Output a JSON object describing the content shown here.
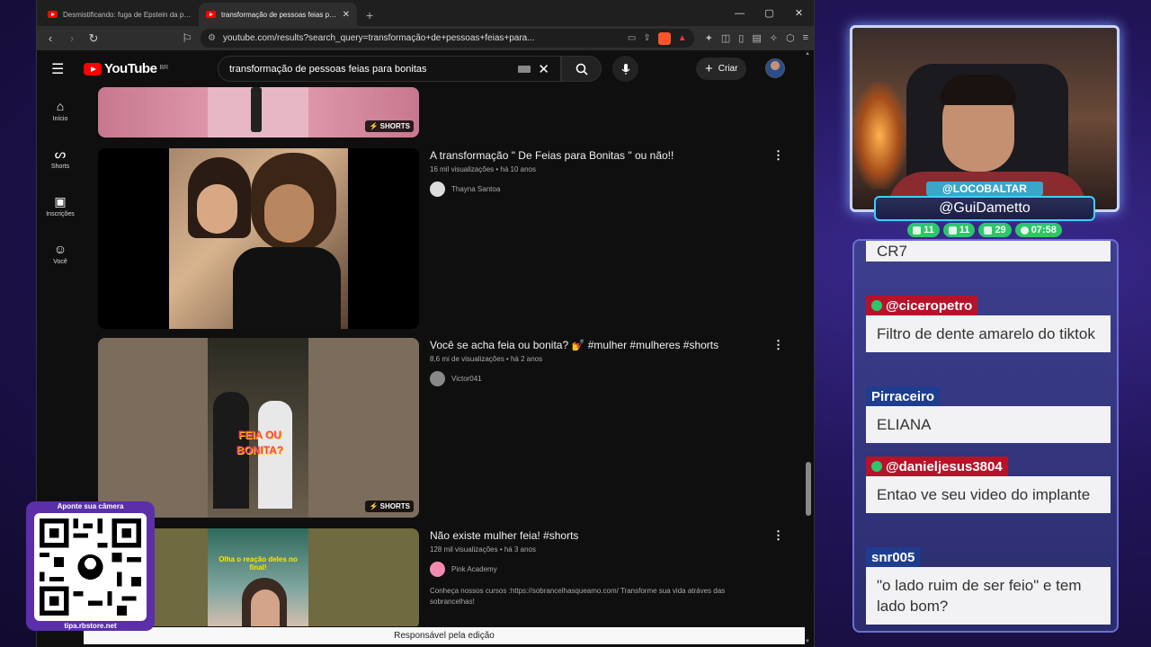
{
  "browser": {
    "tabs": [
      {
        "title": "Desmistificando: fuga de Epstein da prisão e",
        "active": false
      },
      {
        "title": "transformação de pessoas feias para b",
        "active": true
      }
    ],
    "url": "youtube.com/results?search_query=transformação+de+pessoas+feias+para..."
  },
  "youtube": {
    "logo_text": "YouTube",
    "country": "BR",
    "search_query": "transformação de pessoas feias para bonitas",
    "create_label": "Criar",
    "sidebar": [
      {
        "label": "Início",
        "icon": "home-icon",
        "glyph": "⌂"
      },
      {
        "label": "Shorts",
        "icon": "shorts-icon",
        "glyph": "ᔕ"
      },
      {
        "label": "Inscrições",
        "icon": "subscriptions-icon",
        "glyph": "▣"
      },
      {
        "label": "Você",
        "icon": "you-icon",
        "glyph": "☺"
      }
    ],
    "shorts_badge": "SHORTS",
    "videos": [
      {
        "title": "A transformação \" De Feias para Bonitas \" ou não!!",
        "meta": "16 mil visualizações • há 10 anos",
        "channel": "Thayna Santoa"
      },
      {
        "title": "Você se acha feia ou bonita? 💅 #mulher #mulheres #shorts",
        "meta": "8,6 mi de visualizações • há 2 anos",
        "channel": "Victor041",
        "overlay_text": "FEIA OU BONITA?"
      },
      {
        "title": "Não existe mulher feia! #shorts",
        "meta": "128 mil visualizações • há 3 anos",
        "channel": "Pink Academy",
        "description": "Conheça nossos cursos :https://sobrancelhasqueamo.com/ Transforme sua vida atráves das sobrancelhas!",
        "overlay_text": "Olha o reação deles no final!"
      }
    ],
    "footer": "Responsável pela edição"
  },
  "stream": {
    "top_tag": "@LOCOBALTAR",
    "main_tag": "@GuiDametto",
    "stats": [
      {
        "value": "11",
        "icon": "twitch-icon"
      },
      {
        "value": "11",
        "icon": "youtube-icon"
      },
      {
        "value": "29",
        "icon": "kick-icon"
      },
      {
        "value": "07:58",
        "icon": "clock-icon"
      }
    ],
    "chat": [
      {
        "user": "",
        "text": "CR7",
        "partial": true
      },
      {
        "user": "@ciceropetro",
        "text": "Filtro de dente amarelo do tiktok",
        "style": "red"
      },
      {
        "user": "Pirraceiro",
        "text": "ELIANA",
        "style": "blue"
      },
      {
        "user": "@danieljesus3804",
        "text": "Entao ve seu video do implante",
        "style": "red"
      },
      {
        "user": "snr005",
        "text": "\"o lado ruim de ser feio\" e tem lado bom?",
        "style": "blue"
      }
    ],
    "qr_header": "Aponte sua câmera",
    "qr_footer": "tipa.rbstore.net"
  },
  "colors": {
    "youtube_red": "#ff0000",
    "chat_red": "#b8122a",
    "chat_blue": "#1f3d8f",
    "stat_green": "#2cc76a"
  }
}
